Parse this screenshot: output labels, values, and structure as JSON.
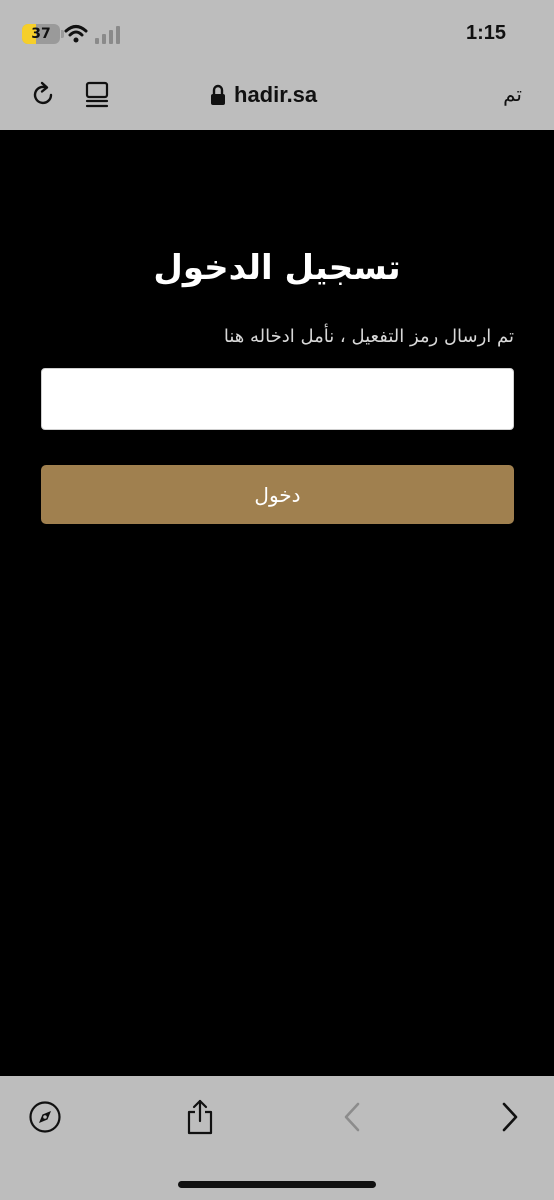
{
  "status_bar": {
    "battery_level": "37",
    "battery_fraction": 0.37,
    "battery_color": "#f6cf2a",
    "time": "1:15",
    "icons": [
      "wifi-icon",
      "signal-icon"
    ]
  },
  "browser": {
    "url": "hadir.sa",
    "done_label": "تم",
    "icons": [
      "reload-icon",
      "reader-icon",
      "lock-icon",
      "compass-icon",
      "share-icon",
      "back-chevron-icon",
      "forward-chevron-icon"
    ]
  },
  "login": {
    "title": "تسجيل الدخول",
    "instruction": "تم ارسال رمز التفعيل ، نأمل ادخاله هنا",
    "code_value": "",
    "button_label": "دخول"
  },
  "colors": {
    "chrome_bg": "#bdbdbd",
    "page_bg": "#000000",
    "button_bg": "#a0804f"
  }
}
